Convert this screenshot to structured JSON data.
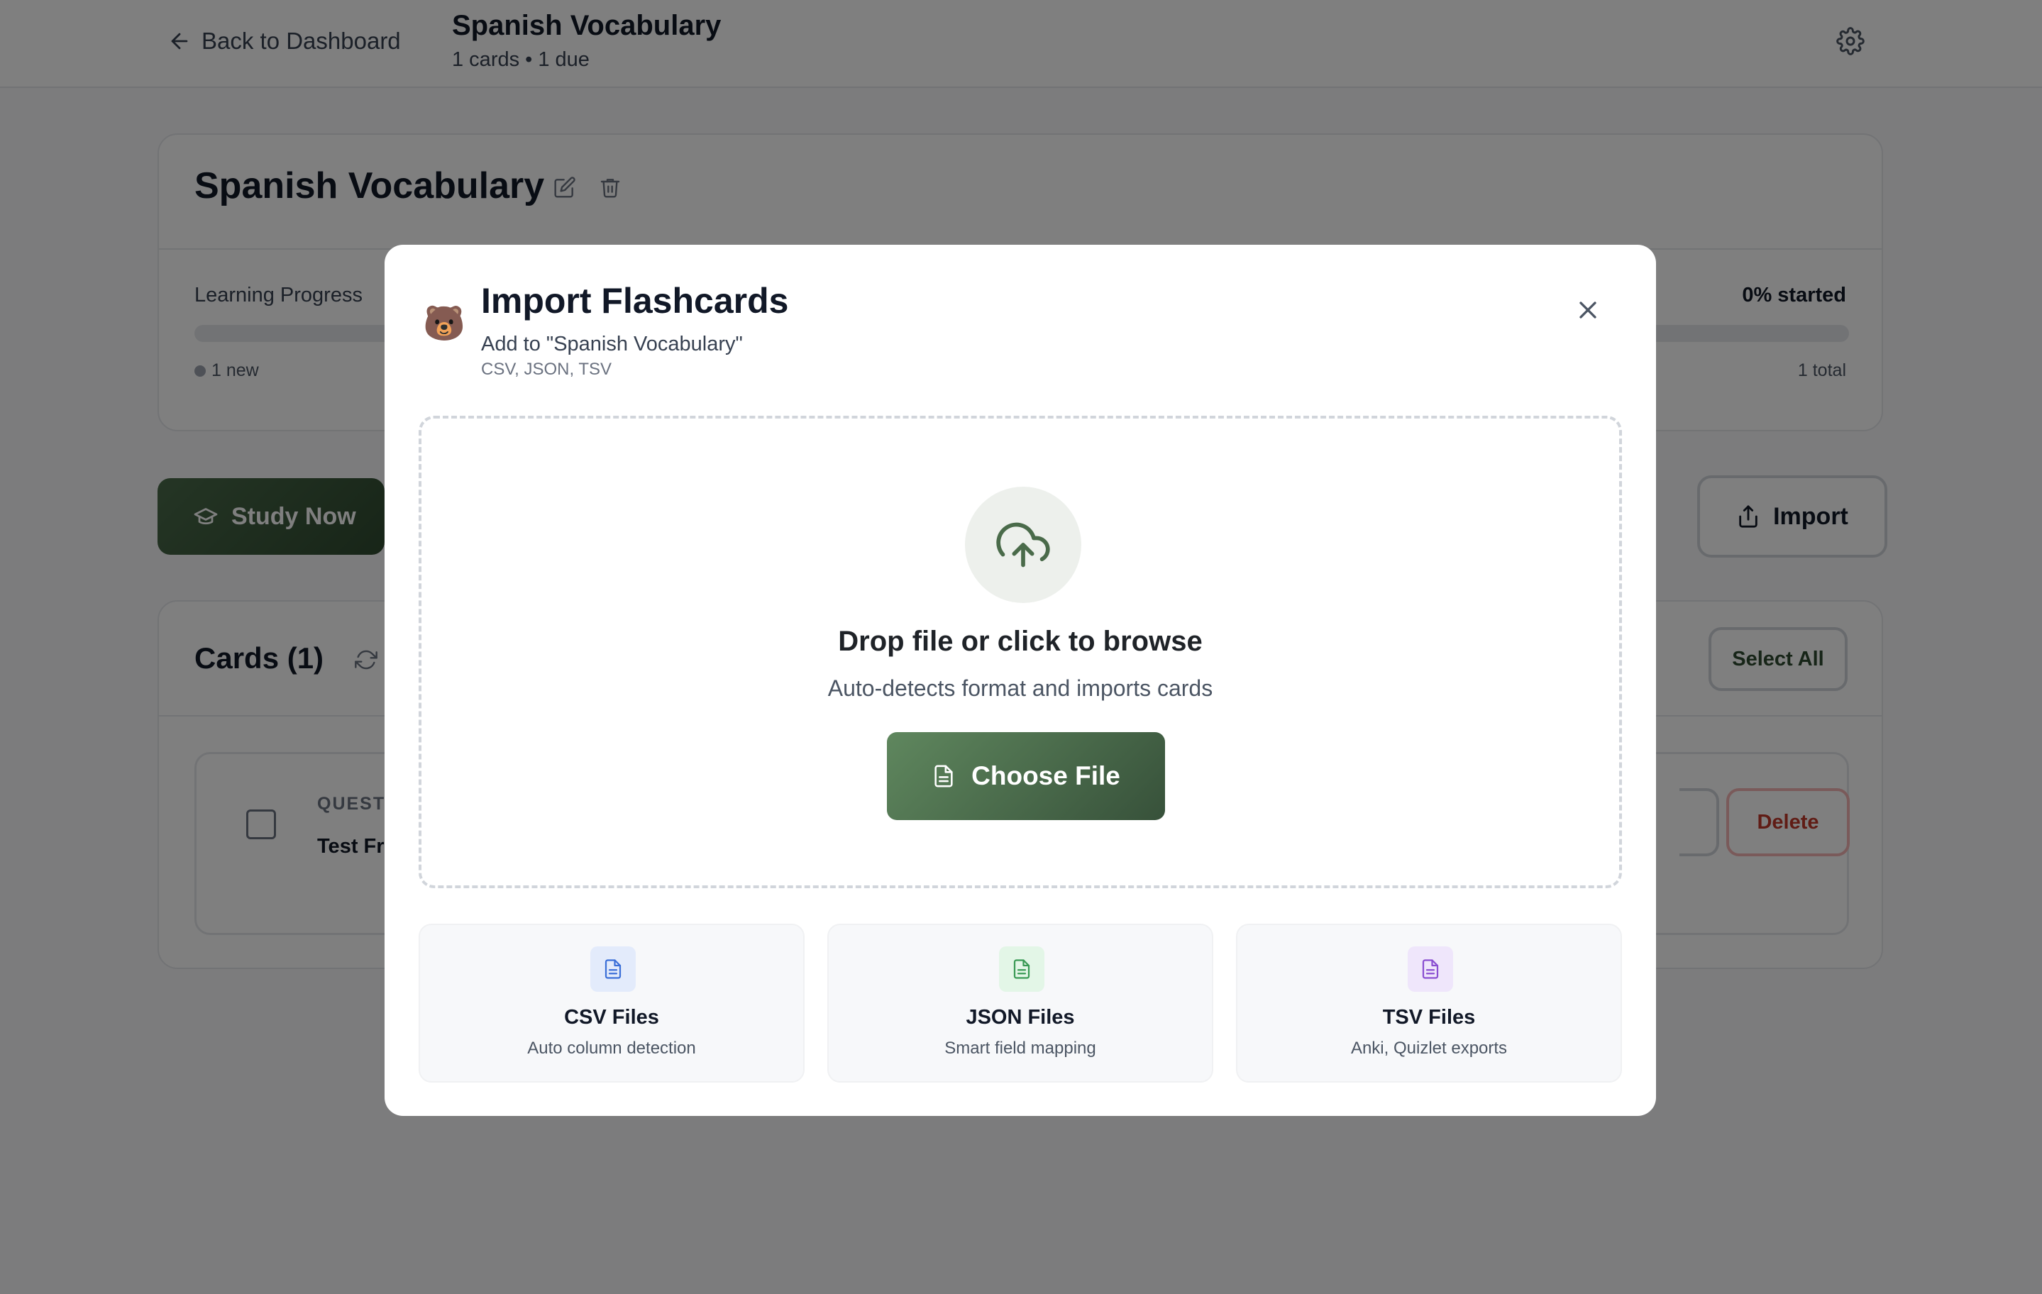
{
  "header": {
    "back_label": "Back to Dashboard",
    "deck_title": "Spanish Vocabulary",
    "deck_subtitle": "1 cards • 1 due"
  },
  "deck_panel": {
    "title": "Spanish Vocabulary",
    "progress_label": "Learning Progress",
    "progress_percent_label": "0% started",
    "progress_fraction": 0,
    "new_count_label": "1 new",
    "total_label": "1 total"
  },
  "actions": {
    "study_label": "Study Now",
    "import_label": "Import"
  },
  "cards_panel": {
    "title": "Cards (1)",
    "select_all_label": "Select All",
    "items": [
      {
        "question_label": "QUESTIC",
        "question_text": "Test Fro",
        "delete_label": "Delete"
      }
    ]
  },
  "modal": {
    "title": "Import Flashcards",
    "subtitle": "Add to \"Spanish Vocabulary\"",
    "formats_line": "CSV, JSON, TSV",
    "mascot": "🐻",
    "dropzone": {
      "title": "Drop file or click to browse",
      "subtitle": "Auto-detects format and imports cards",
      "button_label": "Choose File"
    },
    "file_types": [
      {
        "name": "CSV Files",
        "desc": "Auto column detection",
        "icon": "file-text-icon",
        "bg": "#e3ebfb",
        "fg": "#3b6fd8"
      },
      {
        "name": "JSON Files",
        "desc": "Smart field mapping",
        "icon": "file-text-icon",
        "bg": "#e3f6e7",
        "fg": "#3a9a55"
      },
      {
        "name": "TSV Files",
        "desc": "Anki, Quizlet exports",
        "icon": "file-text-icon",
        "bg": "#efe6fb",
        "fg": "#8a4fd1"
      }
    ]
  },
  "colors": {
    "primary_green": "#37513a",
    "danger": "#c0392b",
    "overlay": "rgba(0,0,0,0.5)"
  }
}
